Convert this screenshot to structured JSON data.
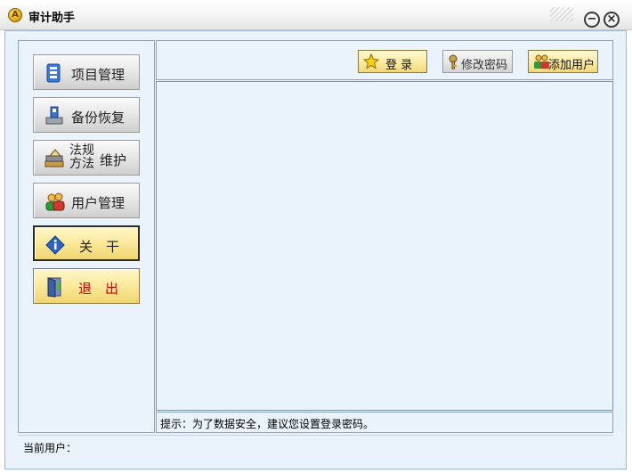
{
  "window": {
    "title": "审计助手",
    "app_icon_glyph": "A"
  },
  "sidebar": {
    "items": [
      {
        "label": "项目管理",
        "icon": "project-icon"
      },
      {
        "label": "备份恢复",
        "icon": "backup-icon"
      },
      {
        "label_line1": "法规",
        "label_line2": "方法",
        "label_side": "维护",
        "icon": "books-icon"
      },
      {
        "label": "用户管理",
        "icon": "users-icon"
      },
      {
        "label": "关　干",
        "icon": "info-icon"
      },
      {
        "label": "退　出",
        "icon": "exit-door-icon"
      }
    ]
  },
  "toolbar": {
    "login_label": "登 录",
    "change_password_label": "修改密码",
    "add_user_label": "添加用户"
  },
  "hint": {
    "text": "提示：为了数据安全，建议您设置登录密码。"
  },
  "status": {
    "current_user_label": "当前用户："
  },
  "colors": {
    "panel_bg": "#eaf3fc",
    "exit_text": "#d00000",
    "yellow_button": "#fbe99a"
  }
}
